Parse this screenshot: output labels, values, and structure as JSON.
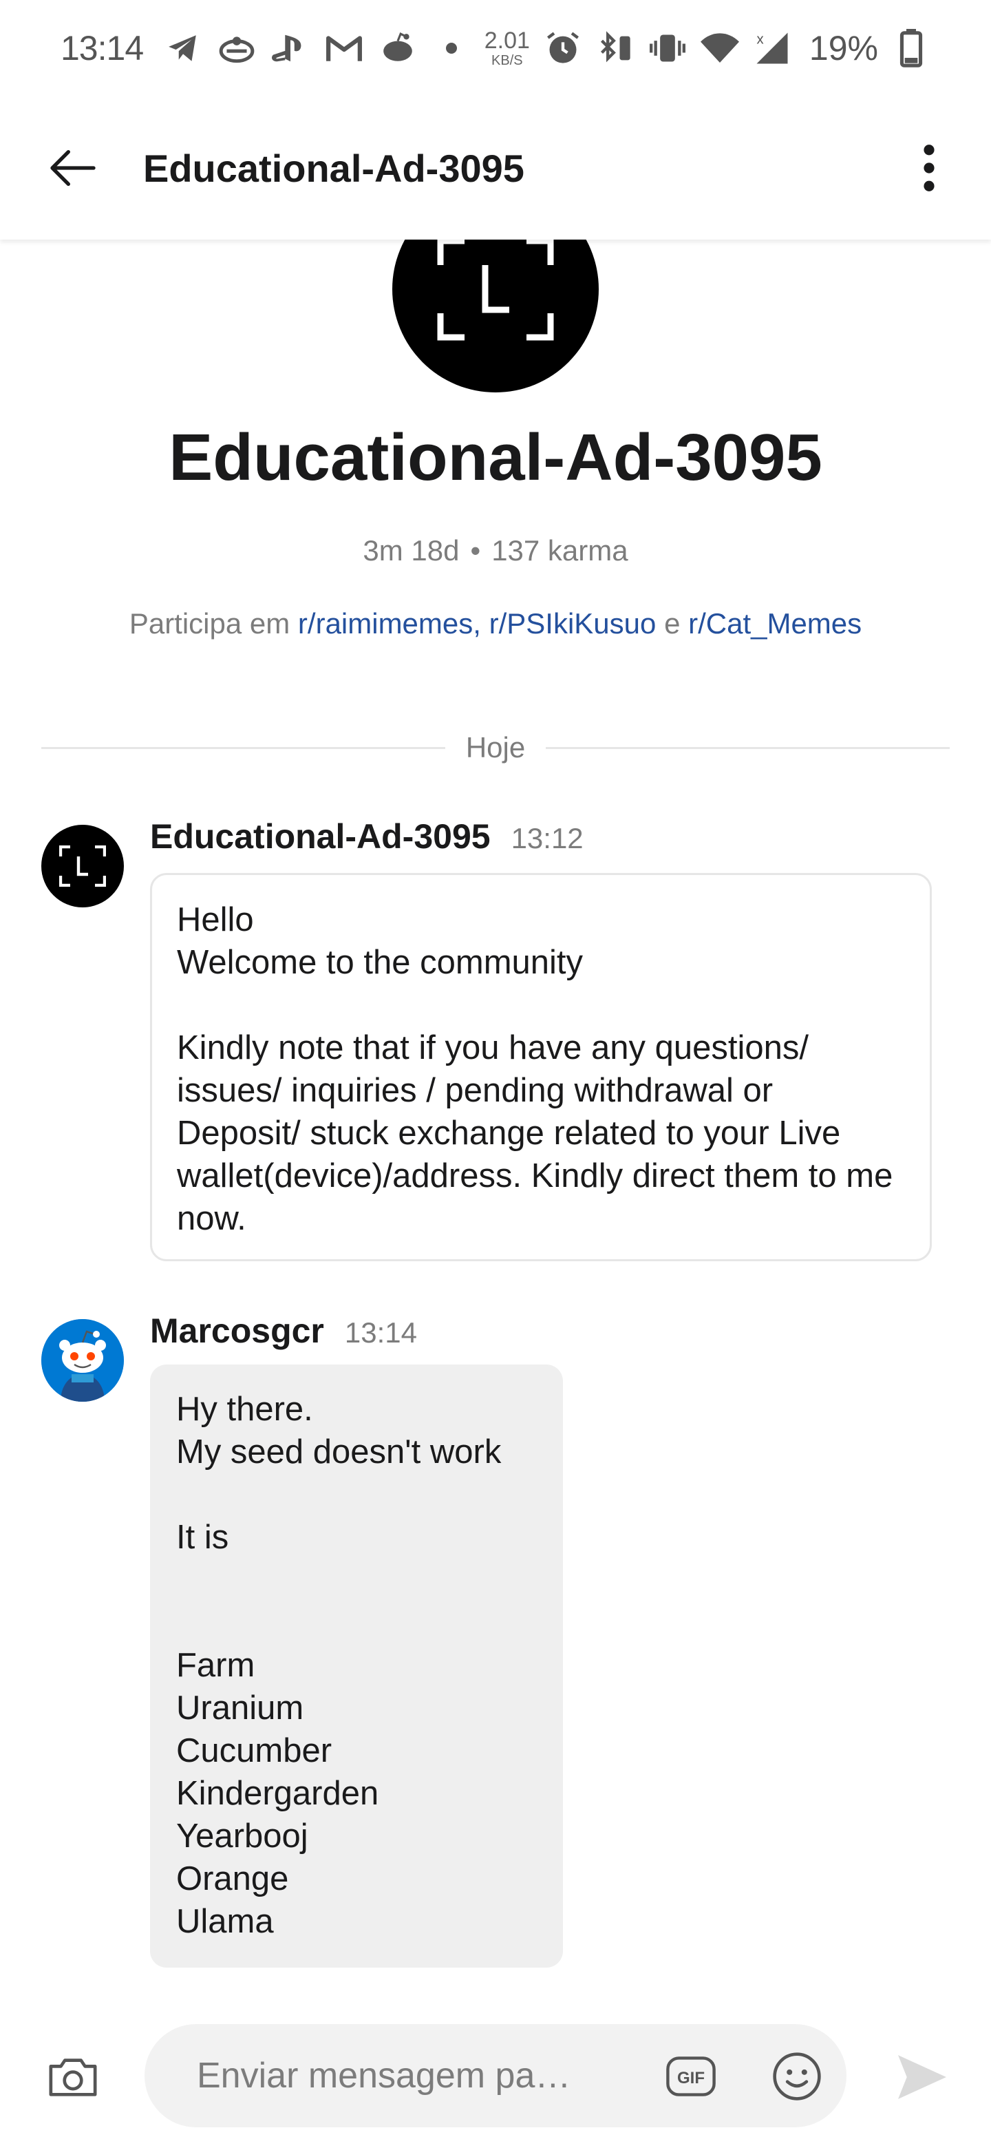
{
  "status_bar": {
    "time": "13:14",
    "net_speed_value": "2.01",
    "net_speed_unit": "KB/S",
    "battery": "19%",
    "left_icons": [
      "telegram-icon",
      "game-icon",
      "playstation-icon",
      "gmail-icon",
      "reddit-icon",
      "dot-icon"
    ],
    "right_icons": [
      "alarm-icon",
      "bluetooth-battery-icon",
      "vibrate-icon",
      "wifi-icon",
      "signal-icon",
      "battery-icon"
    ]
  },
  "header": {
    "title": "Educational-Ad-3095"
  },
  "profile": {
    "name": "Educational-Ad-3095",
    "age": "3m 18d",
    "separator": "•",
    "karma": "137 karma",
    "communities_prefix": "Participa em",
    "communities": [
      "r/raimimemes,",
      "r/PSIkiKusuo",
      "r/Cat_Memes"
    ],
    "communities_conjunction": "e"
  },
  "day_divider": "Hoje",
  "messages": [
    {
      "author": "Educational-Ad-3095",
      "time": "13:12",
      "text": "Hello\nWelcome to the community\n\nKindly note that if you have any questions/ issues/ inquiries / pending withdrawal or Deposit/ stuck exchange related to your Live wallet(device)/address. Kindly direct them to me now."
    },
    {
      "author": "Marcosgcr",
      "time": "13:14",
      "text": "Hy there.\nMy seed doesn't work\n\nIt is\n\n\nFarm\nUranium\nCucumber\nKindergarden\nYearbooj\nOrange\nUlama"
    }
  ],
  "composer": {
    "placeholder": "Enviar mensagem pa…",
    "gif_label": "GIF"
  },
  "colors": {
    "link": "#24509d",
    "muted": "#7c7c7c",
    "bubble_in_bg": "#efefef",
    "reddit_avatar_bg": "#0079d3"
  }
}
